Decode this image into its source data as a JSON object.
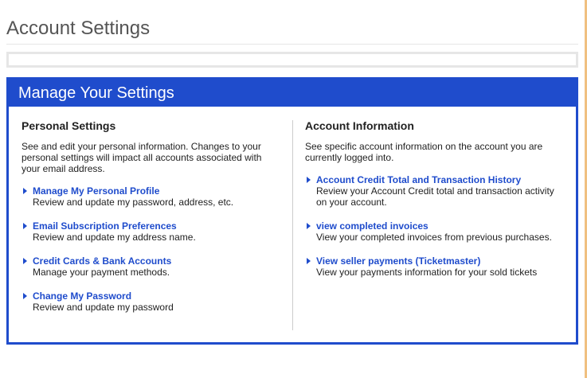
{
  "page": {
    "title": "Account Settings"
  },
  "panel": {
    "title": "Manage Your Settings",
    "accent_color": "#1f4ccc"
  },
  "personal": {
    "heading": "Personal Settings",
    "description": "See and edit your personal information. Changes to your personal settings will impact all accounts associated with your email address.",
    "items": [
      {
        "label": "Manage My Personal Profile",
        "description": "Review and update my password, address, etc."
      },
      {
        "label": "Email Subscription Preferences",
        "description": "Review and update my address name."
      },
      {
        "label": "Credit Cards & Bank Accounts",
        "description": "Manage your payment methods."
      },
      {
        "label": "Change My Password",
        "description": "Review and update my password"
      }
    ]
  },
  "account": {
    "heading": "Account Information",
    "description": "See specific account information on the account you are currently logged into.",
    "items": [
      {
        "label": "Account Credit Total and Transaction History",
        "description": "Review your Account Credit total and transaction activity on your account."
      },
      {
        "label": "view completed invoices",
        "description": "View your completed invoices from previous purchases."
      },
      {
        "label": "View seller payments (Ticketmaster)",
        "description": "View your payments information for your sold tickets"
      }
    ]
  }
}
